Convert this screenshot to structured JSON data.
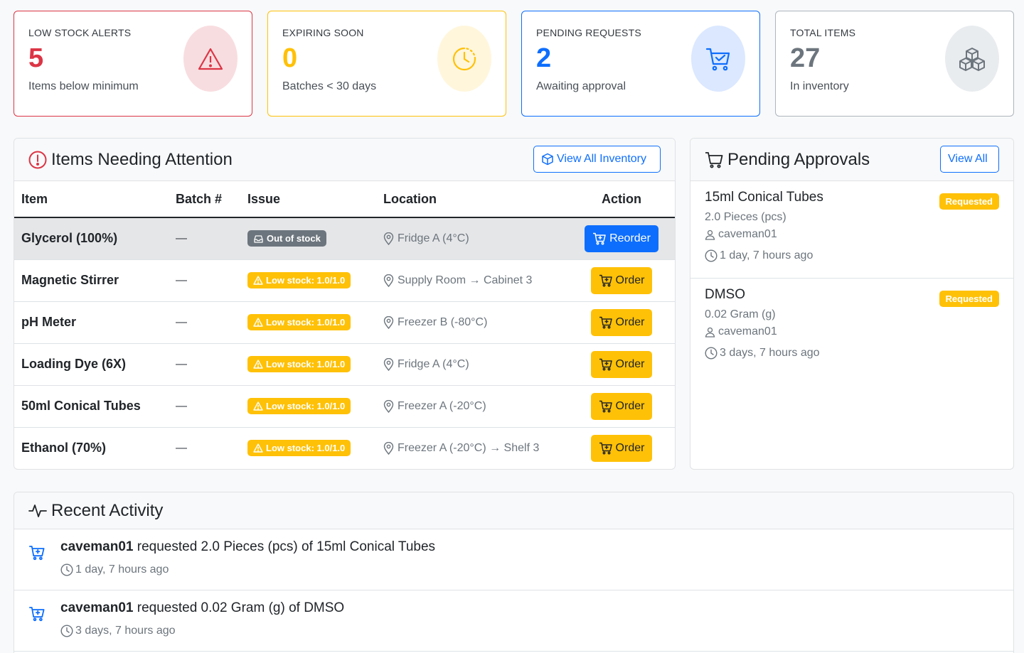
{
  "stats": [
    {
      "label": "LOW STOCK ALERTS",
      "value": "5",
      "sub": "Items below minimum",
      "icon": "warning-icon",
      "color": "#dc3545"
    },
    {
      "label": "EXPIRING SOON",
      "value": "0",
      "sub": "Batches < 30 days",
      "icon": "clock-icon",
      "color": "#ffc107"
    },
    {
      "label": "PENDING REQUESTS",
      "value": "2",
      "sub": "Awaiting approval",
      "icon": "cart-check-icon",
      "color": "#0d6efd"
    },
    {
      "label": "TOTAL ITEMS",
      "value": "27",
      "sub": "In inventory",
      "icon": "boxes-icon",
      "color": "#6c757d"
    }
  ],
  "attention": {
    "title": "Items Needing Attention",
    "view_all_label": "View All Inventory",
    "columns": [
      "Item",
      "Batch #",
      "Issue",
      "Location",
      "Action"
    ],
    "rows": [
      {
        "item": "Glycerol (100%)",
        "batch": "—",
        "issue": "Out of stock",
        "issue_type": "dark",
        "location": "Fridge A (4°C)",
        "action": "Reorder",
        "action_type": "primary"
      },
      {
        "item": "Magnetic Stirrer",
        "batch": "—",
        "issue": "Low stock: 1.0/1.0",
        "issue_type": "warn",
        "location": "Supply Room → Cabinet 3",
        "action": "Order",
        "action_type": "warn"
      },
      {
        "item": "pH Meter",
        "batch": "—",
        "issue": "Low stock: 1.0/1.0",
        "issue_type": "warn",
        "location": "Freezer B (-80°C)",
        "action": "Order",
        "action_type": "warn"
      },
      {
        "item": "Loading Dye (6X)",
        "batch": "—",
        "issue": "Low stock: 1.0/1.0",
        "issue_type": "warn",
        "location": "Fridge A (4°C)",
        "action": "Order",
        "action_type": "warn"
      },
      {
        "item": "50ml Conical Tubes",
        "batch": "—",
        "issue": "Low stock: 1.0/1.0",
        "issue_type": "warn",
        "location": "Freezer A (-20°C)",
        "action": "Order",
        "action_type": "warn"
      },
      {
        "item": "Ethanol (70%)",
        "batch": "—",
        "issue": "Low stock: 1.0/1.0",
        "issue_type": "warn",
        "location": "Freezer A (-20°C) → Shelf 3",
        "action": "Order",
        "action_type": "warn"
      }
    ]
  },
  "approvals": {
    "title": "Pending Approvals",
    "view_all_label": "View All",
    "items": [
      {
        "name": "15ml Conical Tubes",
        "qty": "2.0 Pieces (pcs)",
        "user": "caveman01",
        "time": "1 day, 7 hours ago",
        "status": "Requested"
      },
      {
        "name": "DMSO",
        "qty": "0.02 Gram (g)",
        "user": "caveman01",
        "time": "3 days, 7 hours ago",
        "status": "Requested"
      }
    ]
  },
  "activity": {
    "title": "Recent Activity",
    "items": [
      {
        "user": "caveman01",
        "text": " requested 2.0 Pieces (pcs) of 15ml Conical Tubes",
        "time": "1 day, 7 hours ago"
      },
      {
        "user": "caveman01",
        "text": " requested 0.02 Gram (g) of DMSO",
        "time": "3 days, 7 hours ago"
      }
    ]
  },
  "colors": {
    "danger": "#dc3545",
    "warning": "#ffc107",
    "primary": "#0d6efd",
    "secondary": "#6c757d"
  }
}
